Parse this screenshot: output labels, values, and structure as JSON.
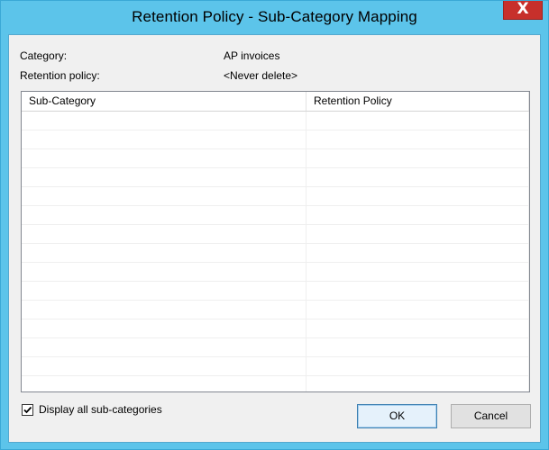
{
  "window": {
    "title": "Retention Policy - Sub-Category Mapping",
    "close_glyph": "X",
    "close_icon": "close-icon"
  },
  "fields": {
    "category_label": "Category:",
    "category_value": "AP invoices",
    "policy_label": "Retention policy:",
    "policy_value": "<Never delete>"
  },
  "grid": {
    "columns": [
      "Sub-Category",
      "Retention Policy"
    ],
    "rows": []
  },
  "options": {
    "display_all_label": "Display all sub-categories",
    "display_all_checked": true
  },
  "buttons": {
    "ok_label": "OK",
    "cancel_label": "Cancel"
  },
  "colors": {
    "window_frame": "#5cc4ea",
    "close_button": "#c7302b",
    "ok_button_border": "#3c7fb1"
  }
}
